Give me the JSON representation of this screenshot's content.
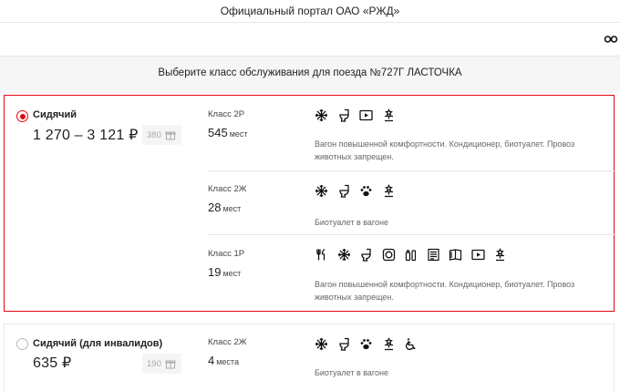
{
  "portal": {
    "title": "Официальный портал ОАО «РЖД»"
  },
  "header": {
    "select_text": "Выберите класс обслуживания для поезда №727Г ЛАСТОЧКА"
  },
  "cards": [
    {
      "name": "Сидячий",
      "price": "1 270 – 3 121 ₽",
      "bonus": "380",
      "selected": true,
      "cars": [
        {
          "label": "Класс 2Р",
          "seats": "545",
          "seats_unit": "мест",
          "icons": [
            "snowflake-icon",
            "toilet-icon",
            "video-icon",
            "accessibility-icon"
          ],
          "note": "Вагон повышенной комфортности. Кондиционер, биотуалет. Провоз животных запрещен."
        },
        {
          "label": "Класс 2Ж",
          "seats": "28",
          "seats_unit": "мест",
          "icons": [
            "snowflake-icon",
            "toilet-icon",
            "pet-icon",
            "accessibility-icon"
          ],
          "note": "Биотуалет в вагоне"
        },
        {
          "label": "Класс 1Р",
          "seats": "19",
          "seats_unit": "мест",
          "icons": [
            "fork-knife-icon",
            "snowflake-icon",
            "toilet-icon",
            "socket-icon",
            "hygiene-icon",
            "newspaper-icon",
            "book-icon",
            "video-icon",
            "accessibility-icon"
          ],
          "note": "Вагон повышенной комфортности. Кондиционер, биотуалет. Провоз животных запрещен."
        }
      ]
    },
    {
      "name": "Сидячий (для инвалидов)",
      "price": "635 ₽",
      "bonus": "190",
      "selected": false,
      "cars": [
        {
          "label": "Класс 2Ж",
          "seats": "4",
          "seats_unit": "места",
          "icons": [
            "snowflake-icon",
            "toilet-icon",
            "pet-icon",
            "accessibility-icon",
            "wheelchair-icon"
          ],
          "note": "Биотуалет в вагоне"
        }
      ]
    }
  ]
}
